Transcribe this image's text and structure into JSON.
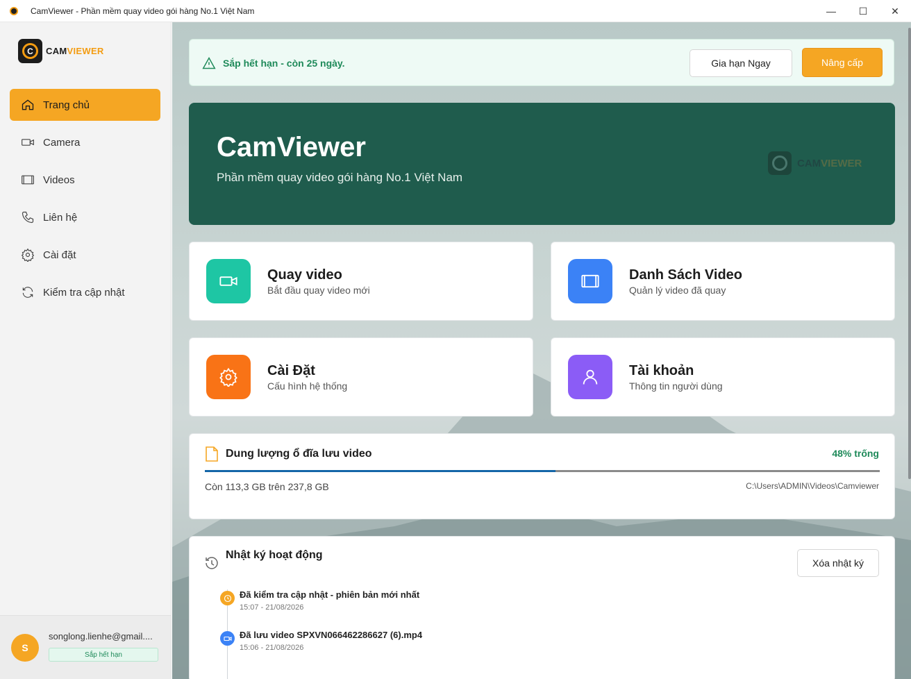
{
  "window": {
    "title": "CamViewer - Phần mềm quay video gói hàng No.1 Việt Nam",
    "controls": [
      "—",
      "☐",
      "✕"
    ]
  },
  "brand": {
    "cam": "CAM",
    "viewer": "VIEWER",
    "mark": "C",
    "accent": "#f5a623",
    "primary": "#1f5c4d"
  },
  "sidebar": {
    "items": [
      {
        "label": "Trang chủ",
        "icon": "home-icon",
        "active": true
      },
      {
        "label": "Camera",
        "icon": "camera-icon"
      },
      {
        "label": "Videos",
        "icon": "film-icon"
      },
      {
        "label": "Liên hệ",
        "icon": "phone-icon"
      },
      {
        "label": "Cài đặt",
        "icon": "gear-icon"
      },
      {
        "label": "Kiểm tra cập nhật",
        "icon": "refresh-icon"
      }
    ],
    "user": {
      "initial": "S",
      "email": "songlong.lienhe@gmail....",
      "status": "Sắp hết hạn"
    }
  },
  "alert": {
    "message": "Sắp hết hạn - còn 25 ngày.",
    "renew_label": "Gia hạn Ngay",
    "upgrade_label": "Nâng cấp"
  },
  "hero": {
    "title": "CamViewer",
    "subtitle": "Phần mềm quay video gói hàng No.1 Việt Nam",
    "logo_cam": "CAM",
    "logo_viewer": "VIEWER"
  },
  "cards": [
    {
      "title": "Quay video",
      "subtitle": "Bắt đầu quay video mới",
      "icon": "video-camera-icon",
      "color": "#1ec6a4"
    },
    {
      "title": "Danh Sách Video",
      "subtitle": "Quản lý video đã quay",
      "icon": "film-icon",
      "color": "#3b82f6"
    },
    {
      "title": "Cài Đặt",
      "subtitle": "Cấu hình hệ thống",
      "icon": "gear-icon",
      "color": "#f97316"
    },
    {
      "title": "Tài khoản",
      "subtitle": "Thông tin người dùng",
      "icon": "user-icon",
      "color": "#8b5cf6"
    }
  ],
  "storage": {
    "title": "Dung lượng ổ đĩa lưu video",
    "free_label": "48% trống",
    "used_fraction": 0.52,
    "summary": "Còn 113,3 GB trên 237,8 GB",
    "path": "C:\\Users\\ADMIN\\Videos\\Camviewer"
  },
  "log": {
    "title": "Nhật ký hoạt động",
    "clear_label": "Xóa nhật ký",
    "entries": [
      {
        "title": "Đã kiểm tra cập nhật - phiên bản mới nhất",
        "time": "15:07 - 21/08/2026",
        "icon": "clock-icon",
        "color": "#f5a623"
      },
      {
        "title": "Đã lưu video SPXVN066462286627 (6).mp4",
        "time": "15:06 - 21/08/2026",
        "icon": "video-camera-icon",
        "color": "#3b82f6"
      }
    ]
  }
}
